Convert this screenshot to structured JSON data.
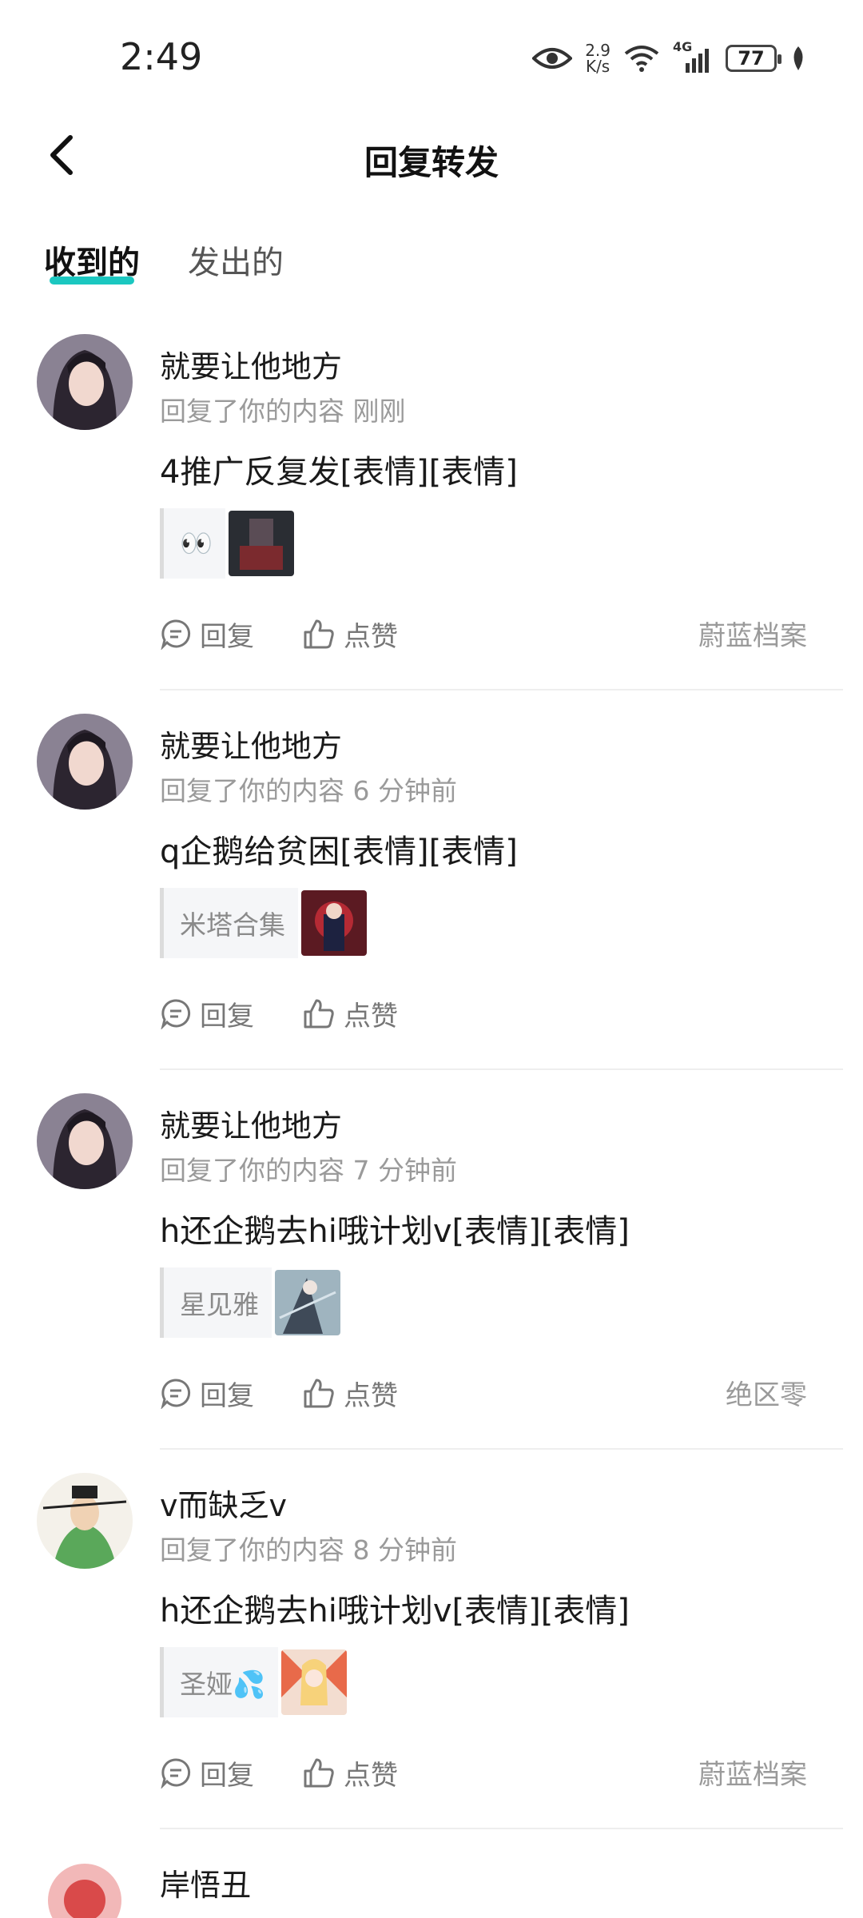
{
  "status": {
    "time": "2:49",
    "speed_value": "2.9",
    "speed_unit": "K/s",
    "network": "4G",
    "battery": "77"
  },
  "header": {
    "title": "回复转发"
  },
  "tabs": [
    {
      "label": "收到的"
    },
    {
      "label": "发出的"
    }
  ],
  "action_labels": {
    "reply": "回复",
    "like": "点赞"
  },
  "items": [
    {
      "name": "就要让他地方",
      "subtitle": "回复了你的内容 刚刚",
      "content": "4推广反复发[表情][表情]",
      "ref_text": "👀",
      "source": "蔚蓝档案"
    },
    {
      "name": "就要让他地方",
      "subtitle": "回复了你的内容 6 分钟前",
      "content": "q企鹅给贫困[表情][表情]",
      "ref_text": "米塔合集",
      "source": ""
    },
    {
      "name": "就要让他地方",
      "subtitle": "回复了你的内容 7 分钟前",
      "content": "h还企鹅去hi哦计划v[表情][表情]",
      "ref_text": "星见雅",
      "source": "绝区零"
    },
    {
      "name": "v而缺乏v",
      "subtitle": "回复了你的内容 8 分钟前",
      "content": "h还企鹅去hi哦计划v[表情][表情]",
      "ref_text": "圣娅💦",
      "source": "蔚蓝档案"
    },
    {
      "name": "岸悟丑"
    }
  ],
  "colors": {
    "accent": "#1bc7c0",
    "secondary_text": "#9a9a9a"
  }
}
